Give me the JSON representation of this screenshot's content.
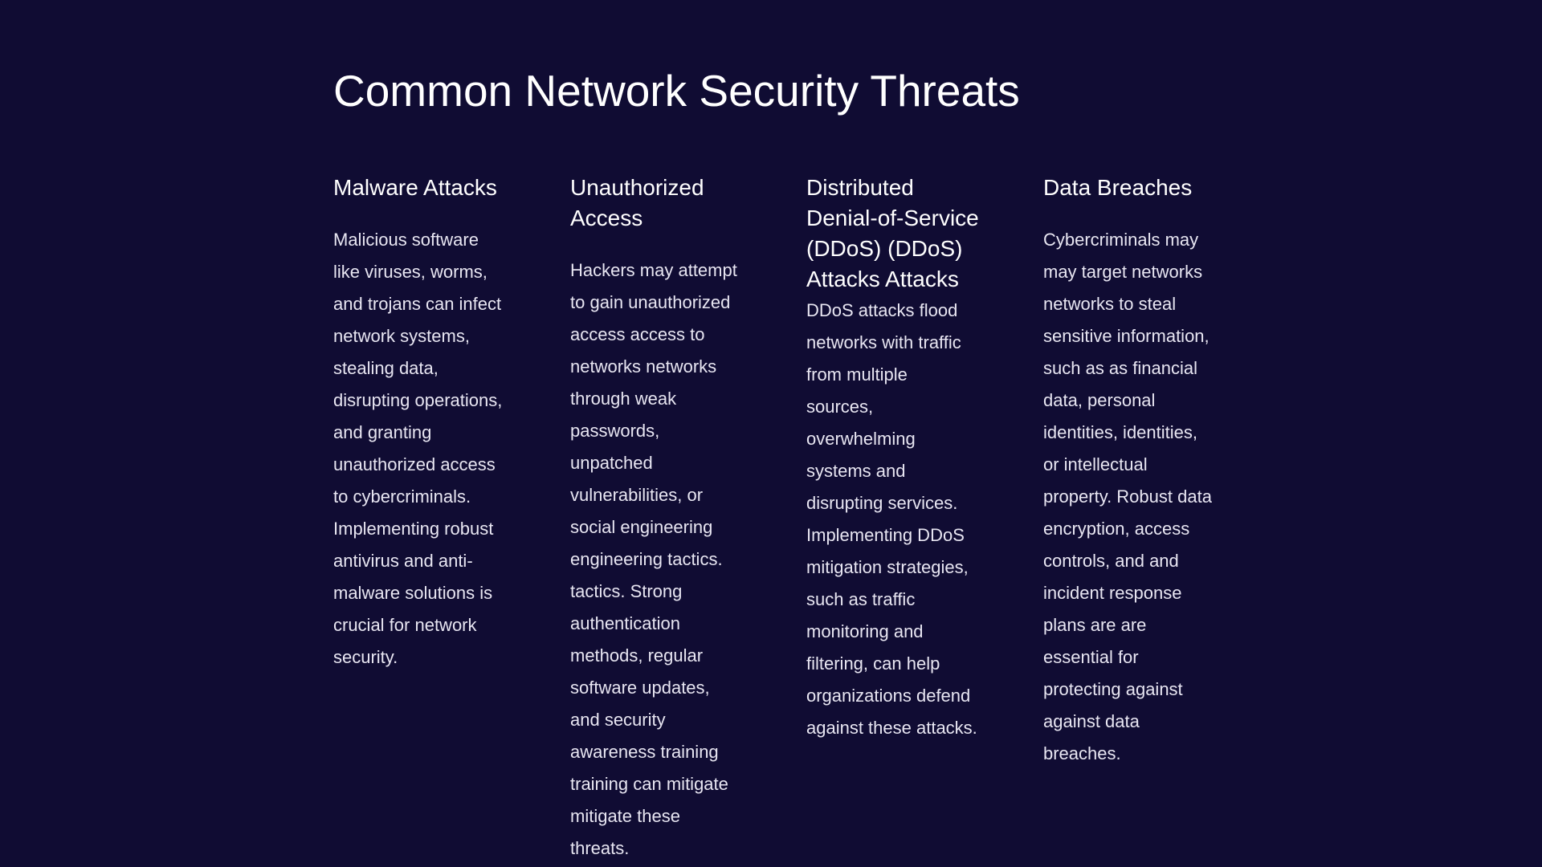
{
  "slide": {
    "title": "Common Network Security Threats",
    "columns": [
      {
        "heading": "Malware Attacks",
        "body": "Malicious software like viruses, worms, and trojans can infect network systems, stealing data, disrupting operations, and granting unauthorized access to cybercriminals. Implementing robust antivirus and anti-malware solutions is crucial for network security."
      },
      {
        "heading": "Unauthorized Access",
        "body": "Hackers may attempt to gain unauthorized access access to networks networks through weak passwords, unpatched vulnerabilities, or social engineering engineering tactics. tactics. Strong authentication methods, regular software updates, and security awareness training training can mitigate mitigate these threats."
      },
      {
        "heading": "Distributed Denial-of-Service (DDoS) (DDoS) Attacks Attacks",
        "body": "DDoS attacks flood networks with traffic from multiple sources, overwhelming systems and disrupting services. Implementing DDoS mitigation strategies, such as traffic monitoring and filtering, can help organizations defend against these attacks."
      },
      {
        "heading": "Data Breaches",
        "body": "Cybercriminals may may target networks networks to steal sensitive information, such as as financial data, personal identities, identities, or intellectual property. Robust data encryption, access controls, and and incident response plans are are essential for protecting against against data breaches."
      }
    ]
  },
  "colors": {
    "background": "#100c33",
    "text": "#ffffff"
  }
}
